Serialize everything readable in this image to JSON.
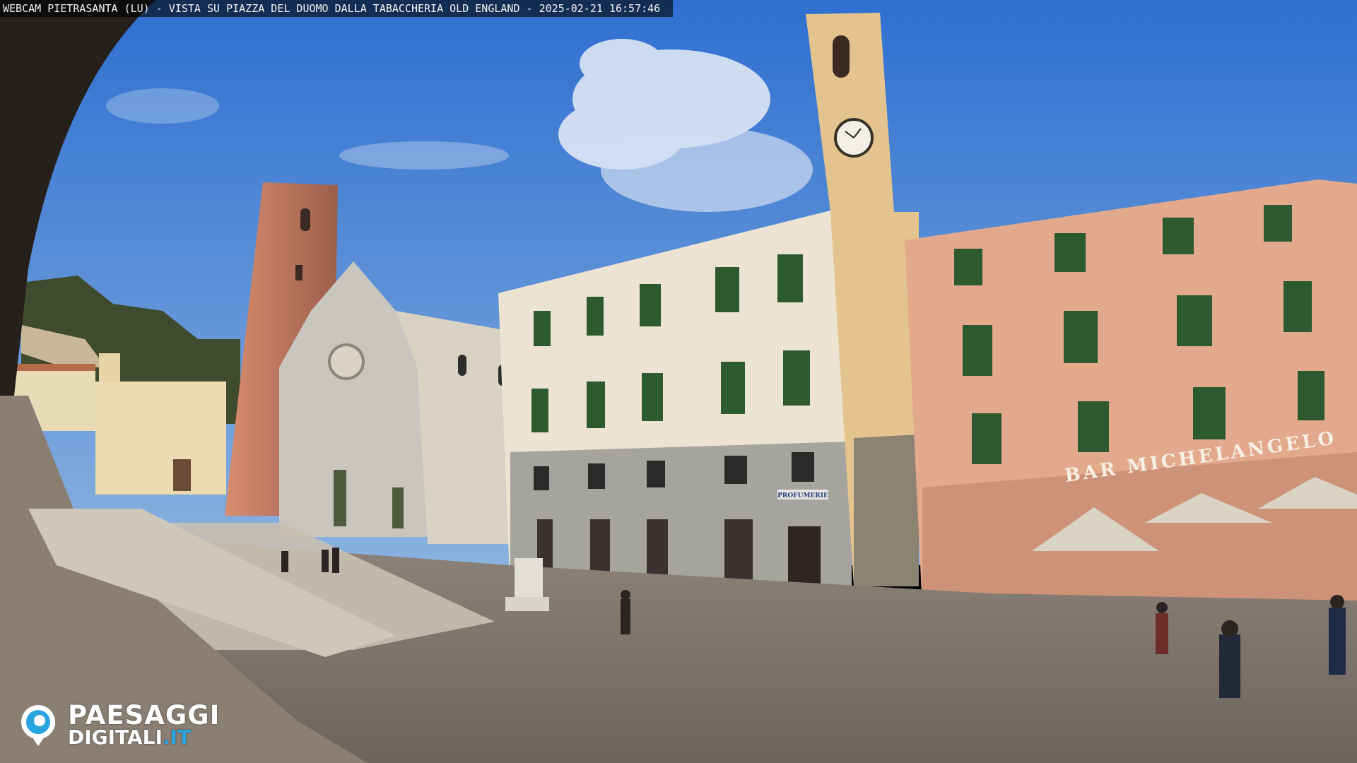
{
  "overlay": {
    "caption": "WEBCAM PIETRASANTA (LU) - VISTA SU PIAZZA DEL DUOMO DALLA TABACCHERIA OLD ENGLAND - 2025-02-21 16:57:46"
  },
  "signage": {
    "bar": "BAR MICHELANGELO",
    "shop": "PROFUMERIE"
  },
  "logo": {
    "line1": "PAESAGGI",
    "line2_main": "DIGITALI",
    "line2_tld": ".IT",
    "icon": "eye-logo-icon",
    "accent": "#29a6e0"
  },
  "colors": {
    "sky": "#4f86d4",
    "pink_facade": "#e3a98c",
    "cream_facade": "#ece3d2",
    "shutter_green": "#2d5a2f"
  }
}
